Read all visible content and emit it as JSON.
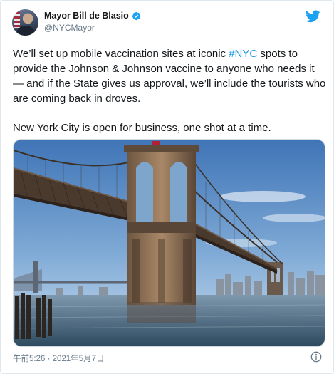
{
  "author": {
    "display_name": "Mayor Bill de Blasio",
    "handle": "@NYCMayor",
    "verified": true,
    "verified_color": "#1da1f2"
  },
  "tweet": {
    "para1_before": "We’ll set up mobile vaccination sites at iconic ",
    "hashtag": "#NYC",
    "para1_after": " spots to provide the Johnson & Johnson vaccine to anyone who needs it — and if the State gives us approval, we’ll include the tourists who are coming back in droves.",
    "para2": "New York City is open for business, one shot at a time.",
    "hashtag_color": "#1b95e0"
  },
  "media": {
    "image_subject": "Brooklyn Bridge over the East River"
  },
  "footer": {
    "timestamp": "午前5:26 · 2021年5月7日"
  },
  "icons": {
    "logo": "twitter-bird-icon",
    "verified": "verified-badge-icon",
    "info": "info-icon"
  },
  "colors": {
    "brand": "#1da1f2",
    "text": "#14171a",
    "muted": "#657786"
  }
}
